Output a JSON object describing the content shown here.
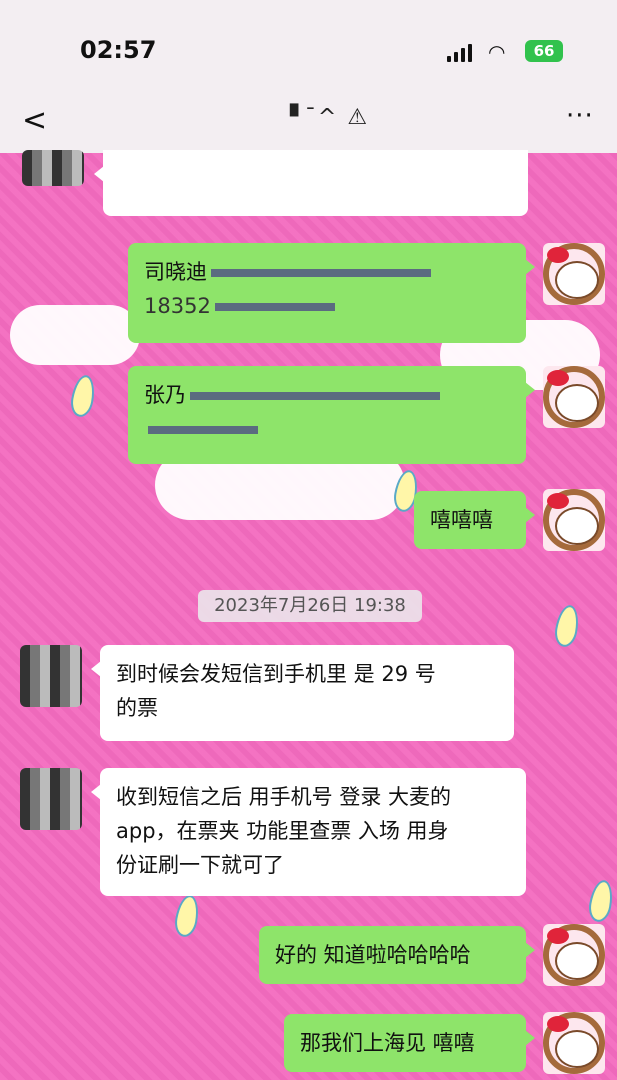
{
  "status": {
    "time": "02:57",
    "battery": "66"
  },
  "nav": {
    "title": "▘ ̄^ ⚠",
    "back": "<",
    "more": "···"
  },
  "messages": {
    "m1": {
      "text": "司晓迪",
      "line2": "18352"
    },
    "m2": {
      "text": "张乃",
      "line2": ""
    },
    "m3": {
      "text": "嘻嘻嘻"
    },
    "timestamp": "2023年7月26日 19:38",
    "m4": {
      "line1": "到时候会发短信到手机里   是 29 号",
      "line2": "的票"
    },
    "m5": {
      "line1": "收到短信之后 用手机号 登录 大麦的",
      "line2": "app，在票夹 功能里查票 入场 用身",
      "line3": "份证刷一下就可了"
    },
    "m6": {
      "text": "好的 知道啦哈哈哈哈"
    },
    "m7": {
      "text": "那我们上海见 嘻嘻"
    }
  },
  "colors": {
    "green_bubble": "#8ee46a",
    "background": "#f36bbf"
  }
}
